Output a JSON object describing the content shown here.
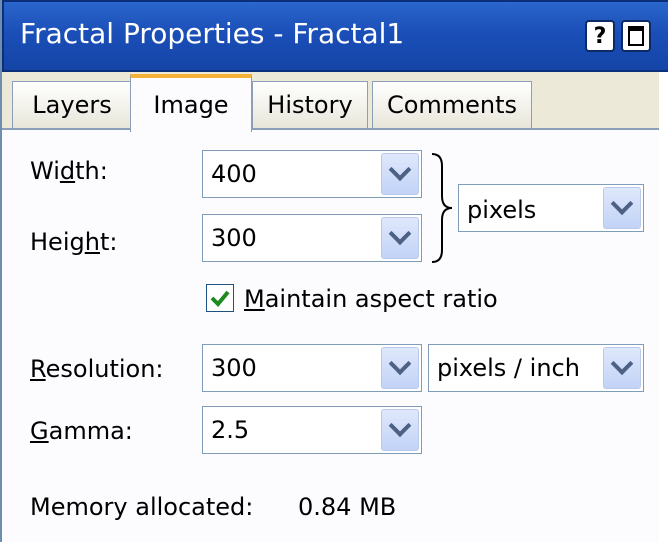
{
  "window": {
    "title": "Fractal Properties - Fractal1",
    "help_label": "?"
  },
  "tabs": [
    {
      "label": "Layers",
      "active": false
    },
    {
      "label": "Image",
      "active": true
    },
    {
      "label": "History",
      "active": false
    },
    {
      "label": "Comments",
      "active": false
    }
  ],
  "form": {
    "width_label_pre": "Wi",
    "width_label_key": "d",
    "width_label_post": "th:",
    "width_value": "400",
    "height_label_pre": "Heig",
    "height_label_key": "h",
    "height_label_post": "t:",
    "height_value": "300",
    "size_unit": "pixels",
    "aspect_key": "M",
    "aspect_rest": "aintain aspect ratio",
    "aspect_checked": true,
    "resolution_label_key": "R",
    "resolution_label_rest": "esolution:",
    "resolution_value": "300",
    "resolution_unit": "pixels / inch",
    "gamma_label_key": "G",
    "gamma_label_rest": "amma:",
    "gamma_value": "2.5",
    "memory_label": "Memory allocated:",
    "memory_value": "0.84 MB"
  },
  "icons": {
    "dropdown": "chevron-down-icon",
    "check": "checkmark-icon",
    "brace": "right-brace-icon"
  },
  "colors": {
    "titlebar": "#1b4fb8",
    "active_tab_accent": "#f4b338",
    "check": "#1f8a1f"
  }
}
